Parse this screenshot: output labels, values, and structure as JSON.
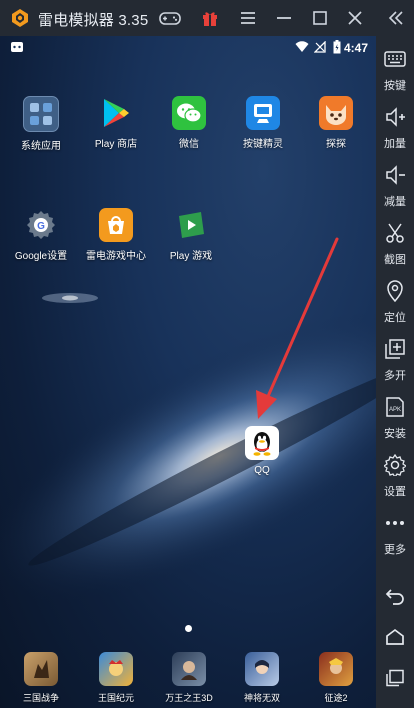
{
  "window": {
    "title": "雷电模拟器 3.35"
  },
  "status_bar": {
    "time": "4:47"
  },
  "home_apps": [
    {
      "label": "系统应用",
      "icon": "system-apps-folder-icon"
    },
    {
      "label": "Play 商店",
      "icon": "play-store-icon"
    },
    {
      "label": "微信",
      "icon": "wechat-icon"
    },
    {
      "label": "按键精灵",
      "icon": "key-wizard-icon"
    },
    {
      "label": "探探",
      "icon": "tantan-icon"
    },
    {
      "label": "Google设置",
      "icon": "google-settings-icon"
    },
    {
      "label": "雷电游戏中心",
      "icon": "ld-game-center-icon"
    },
    {
      "label": "Play 游戏",
      "icon": "play-games-icon"
    },
    {
      "label": "QQ",
      "icon": "qq-icon"
    }
  ],
  "dock_apps": [
    {
      "label": "三国战争",
      "icon": "sanguo-war-icon"
    },
    {
      "label": "王国纪元",
      "icon": "lords-mobile-icon"
    },
    {
      "label": "万王之王3D",
      "icon": "king-of-kings-icon"
    },
    {
      "label": "神将无双",
      "icon": "shenjiang-icon"
    },
    {
      "label": "征途2",
      "icon": "zhengtu-icon"
    }
  ],
  "sidebar": {
    "items": [
      {
        "label": "按键",
        "icon": "keyboard-icon"
      },
      {
        "label": "加量",
        "icon": "volume-up-icon"
      },
      {
        "label": "减量",
        "icon": "volume-down-icon"
      },
      {
        "label": "截图",
        "icon": "scissors-icon"
      },
      {
        "label": "定位",
        "icon": "location-pin-icon"
      },
      {
        "label": "多开",
        "icon": "multi-instance-icon"
      },
      {
        "label": "安装",
        "icon": "apk-install-icon"
      },
      {
        "label": "设置",
        "icon": "gear-icon"
      },
      {
        "label": "更多",
        "icon": "more-dots-icon"
      }
    ]
  },
  "colors": {
    "chrome": "#242a33",
    "arrow": "#e43a3a",
    "accent_orange": "#f39a1e"
  }
}
